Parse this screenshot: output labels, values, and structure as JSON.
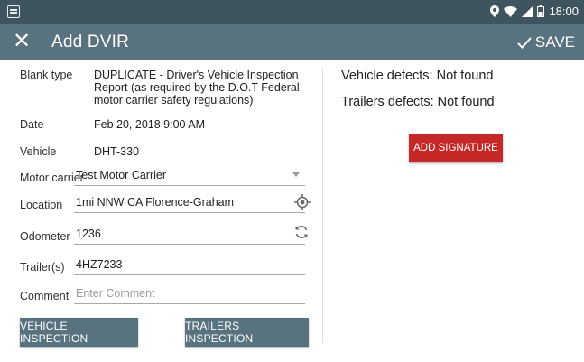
{
  "status_bar": {
    "time": "18:00",
    "icons": [
      "notification-icon",
      "location-icon",
      "wifi-icon",
      "signal-icon",
      "battery-icon"
    ]
  },
  "toolbar": {
    "close_label": "✕",
    "title": "Add DVIR",
    "save_label": "SAVE"
  },
  "form": {
    "blank_type": {
      "label": "Blank type",
      "value": "DUPLICATE - Driver's Vehicle Inspection Report (as required by the D.O.T Federal motor carrier safety regulations)"
    },
    "date": {
      "label": "Date",
      "value": "Feb 20, 2018 9:00 AM"
    },
    "vehicle": {
      "label": "Vehicle",
      "value": "DHT-330"
    },
    "motor_carrier": {
      "label": "Motor carrier",
      "value": "Test Motor Carrier"
    },
    "location": {
      "label": "Location",
      "value": "1mi NNW CA Florence-Graham"
    },
    "odometer": {
      "label": "Odometer",
      "value": "1236"
    },
    "trailers": {
      "label": "Trailer(s)",
      "value": "4HZ7233"
    },
    "comment": {
      "label": "Comment",
      "value": "",
      "placeholder": "Enter Comment"
    }
  },
  "buttons": {
    "vehicle_inspection": "VEHICLE INSPECTION",
    "trailers_inspection": "TRAILERS INSPECTION"
  },
  "defects": {
    "vehicle": "Vehicle defects: Not found",
    "trailers": "Trailers defects: Not found"
  },
  "add_signature": "ADD SIGNATURE",
  "colors": {
    "status_bar": "#3e5560",
    "toolbar": "#58727f",
    "button": "#58727f",
    "signature_button": "#c62828"
  }
}
